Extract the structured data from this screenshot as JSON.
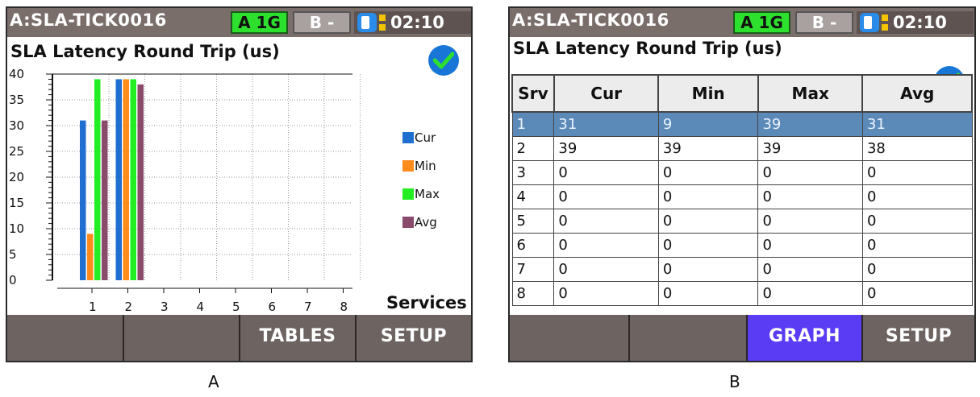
{
  "panels": [
    {
      "status": {
        "title": "A:SLA-TICK0016",
        "port_a": "A 1G",
        "port_b": "B -",
        "time": "02:10"
      },
      "page_title": "SLA Latency Round Trip (us)",
      "footer": [
        "",
        "",
        "TABLES",
        "SETUP"
      ],
      "caption": "A"
    },
    {
      "status": {
        "title": "A:SLA-TICK0016",
        "port_a": "A 1G",
        "port_b": "B -",
        "time": "02:10"
      },
      "page_title": "SLA Latency Round Trip (us)",
      "footer": [
        "",
        "",
        "GRAPH",
        "SETUP"
      ],
      "caption": "B"
    }
  ],
  "colors": {
    "cur": "#1f6fd0",
    "min": "#ff8c1a",
    "max": "#22ee22",
    "avg": "#8a4a6c",
    "active_button": "#5b3cf5"
  },
  "chart_data": {
    "type": "bar",
    "title": "SLA Latency Round Trip (us)",
    "xlabel": "Services",
    "ylabel": "",
    "categories": [
      "1",
      "2",
      "3",
      "4",
      "5",
      "6",
      "7",
      "8"
    ],
    "y_ticks": [
      "0",
      "5",
      "10",
      "15",
      "20",
      "25",
      "30",
      "35",
      "40"
    ],
    "ylim": [
      0,
      40
    ],
    "grid": true,
    "legend_position": "right",
    "series": [
      {
        "name": "Cur",
        "values": [
          31,
          39,
          0,
          0,
          0,
          0,
          0,
          0
        ]
      },
      {
        "name": "Min",
        "values": [
          9,
          39,
          0,
          0,
          0,
          0,
          0,
          0
        ]
      },
      {
        "name": "Max",
        "values": [
          39,
          39,
          0,
          0,
          0,
          0,
          0,
          0
        ]
      },
      {
        "name": "Avg",
        "values": [
          31,
          38,
          0,
          0,
          0,
          0,
          0,
          0
        ]
      }
    ]
  },
  "table": {
    "headers": [
      "Srv",
      "Cur",
      "Min",
      "Max",
      "Avg"
    ],
    "rows": [
      [
        "1",
        "31",
        "9",
        "39",
        "31"
      ],
      [
        "2",
        "39",
        "39",
        "39",
        "38"
      ],
      [
        "3",
        "0",
        "0",
        "0",
        "0"
      ],
      [
        "4",
        "0",
        "0",
        "0",
        "0"
      ],
      [
        "5",
        "0",
        "0",
        "0",
        "0"
      ],
      [
        "6",
        "0",
        "0",
        "0",
        "0"
      ],
      [
        "7",
        "0",
        "0",
        "0",
        "0"
      ],
      [
        "8",
        "0",
        "0",
        "0",
        "0"
      ]
    ],
    "selected_row": 0
  }
}
